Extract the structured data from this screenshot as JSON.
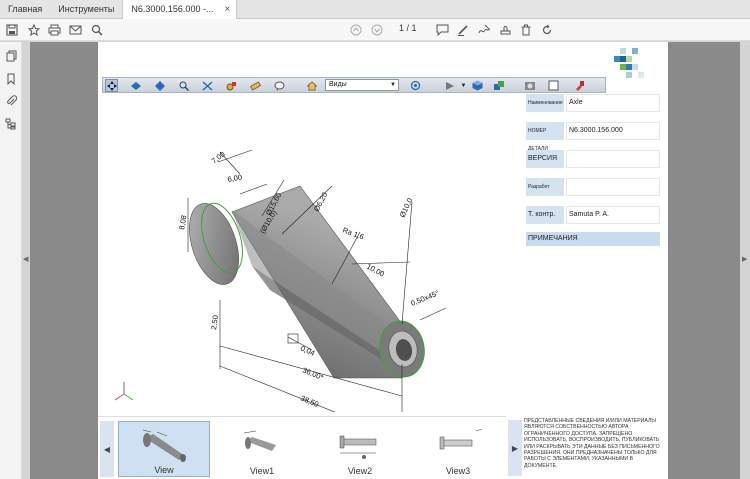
{
  "tabs": [
    {
      "label": "Главная"
    },
    {
      "label": "Инструменты"
    },
    {
      "label": "N6.3000.156.000 -..."
    }
  ],
  "tab_close_symbol": "×",
  "toolbar": {
    "page_current": "1",
    "page_total": "/ 1",
    "icons": [
      "save-icon",
      "star-icon",
      "print-icon",
      "mail-icon",
      "search-icon",
      "page-up-icon",
      "page-down-icon",
      "comment-icon",
      "pen-icon",
      "sign-icon",
      "stamp-icon",
      "delete-icon",
      "rotate-icon"
    ]
  },
  "viewer": {
    "views_label": "Виды"
  },
  "drawing": {
    "dims": [
      "7,00",
      "6,00",
      "8,08",
      "Ø15,60",
      "Ø6,20",
      "(Ø10,0)",
      "Ra 1,6",
      "Ø10,0",
      "10,00",
      "0,50x45°",
      "2,50",
      "0,04",
      "36,00*",
      "38,50"
    ]
  },
  "title_block": {
    "rows": [
      {
        "label": "Наименование",
        "value": "Axle"
      },
      {
        "label": "НОМЕР ДЕТАЛИ",
        "value": "N6.3000.156.000"
      },
      {
        "label": "ВЕРСИЯ",
        "value": ""
      },
      {
        "label": "Разработ",
        "value": ""
      },
      {
        "label": "Т. контр.",
        "value": "Samuta P. A."
      }
    ],
    "notes_heading": "ПРИМЕЧАНИЯ"
  },
  "thumbnails": [
    {
      "label": "View"
    },
    {
      "label": "View1"
    },
    {
      "label": "View2"
    },
    {
      "label": "View3"
    }
  ],
  "disclaimer": "Представленные сведения и/или материалы являются собственностью автора ограниченного доступа. Запрещено использовать, воспроизводить, публиковать или раскрывать эти данные без письменного разрешения. Они предназначены только для работы с элементами, указанными в документе.",
  "colors": {
    "gutter": "#8a8a8a",
    "label_bg": "#d5e2f0",
    "notes_bg": "#c9dcef",
    "thumb_sel": "#cfe0f3"
  }
}
